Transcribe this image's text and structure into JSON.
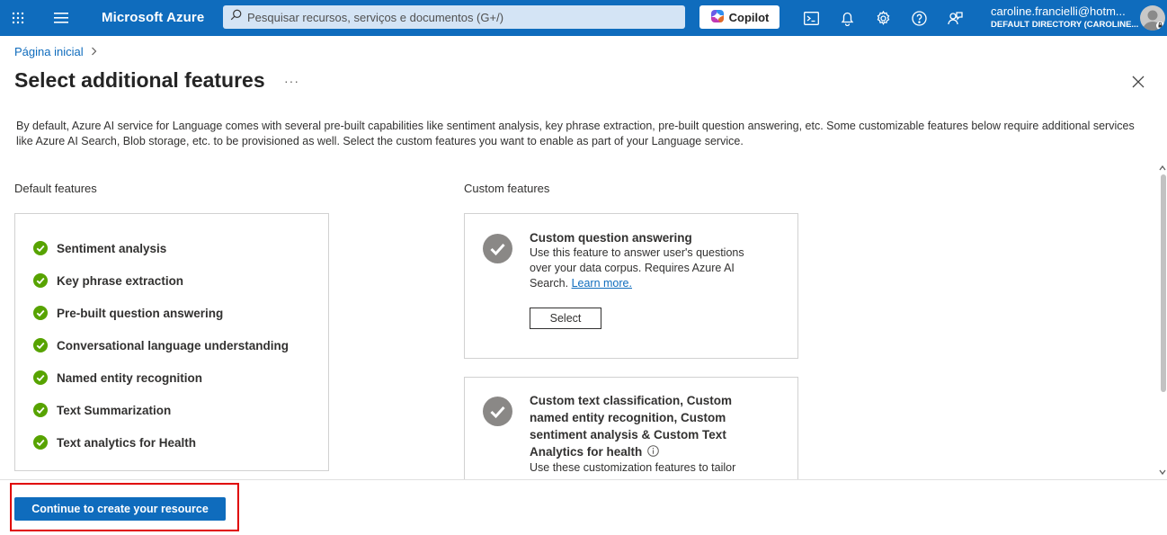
{
  "header": {
    "brand": "Microsoft Azure",
    "search_placeholder": "Pesquisar recursos, serviços e documentos (G+/)",
    "copilot_label": "Copilot",
    "account_email": "caroline.francielli@hotm...",
    "account_directory": "DEFAULT DIRECTORY (CAROLINE...",
    "icons": [
      "waffle-icon",
      "hamburger-icon",
      "search-icon",
      "copilot-icon",
      "cloud-shell-icon",
      "bell-icon",
      "gear-icon",
      "help-icon",
      "feedback-icon",
      "avatar"
    ]
  },
  "breadcrumb": {
    "home": "Página inicial",
    "separator": ">"
  },
  "page": {
    "title": "Select additional features",
    "more": "···",
    "description": "By default, Azure AI service for Language comes with several pre-built capabilities like sentiment analysis, key phrase extraction, pre-built question answering, etc. Some customizable features below require additional services like Azure AI Search, Blob storage, etc. to be provisioned as well. Select the custom features you want to enable as part of your Language service."
  },
  "default_features": {
    "label": "Default features",
    "items": [
      "Sentiment analysis",
      "Key phrase extraction",
      "Pre-built question answering",
      "Conversational language understanding",
      "Named entity recognition",
      "Text Summarization",
      "Text analytics for Health"
    ]
  },
  "custom_features": {
    "label": "Custom features",
    "cards": [
      {
        "title": "Custom question answering",
        "text": "Use this feature to answer user's questions over your data corpus. Requires Azure AI Search.",
        "link": "Learn more.",
        "button": "Select"
      },
      {
        "title": "Custom text classification, Custom named entity recognition, Custom sentiment analysis & Custom Text Analytics for health",
        "text": "Use these customization features to tailor"
      }
    ]
  },
  "footer": {
    "continue_label": "Continue to create your resource"
  },
  "colors": {
    "brand_blue": "#0f6cbd",
    "check_green": "#57a300",
    "highlight_red": "#e00000"
  }
}
